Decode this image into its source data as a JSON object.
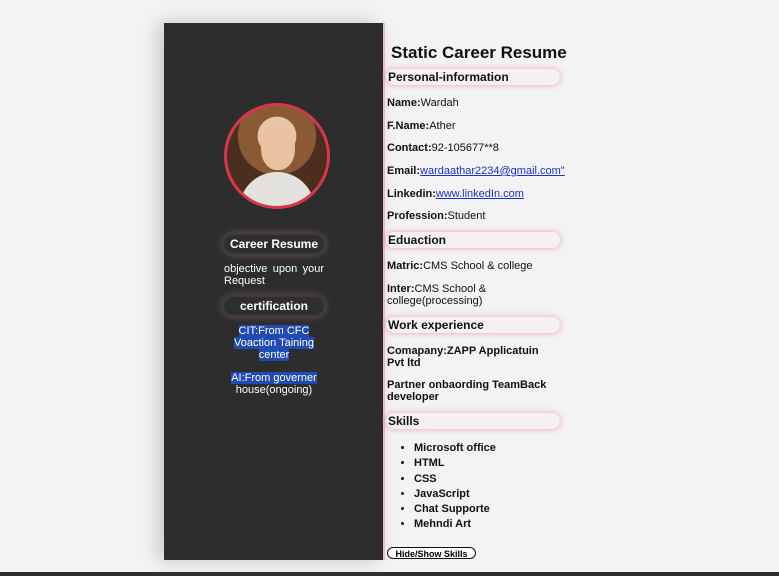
{
  "sidebar": {
    "heading": "Career Resume",
    "objective": "objective upon your Request",
    "certification_heading": "certification",
    "certifications": [
      {
        "title": "CIT:From CFC Voaction Taining center",
        "note": ""
      },
      {
        "title": "AI:From governer",
        "note": "house(ongoing)"
      }
    ]
  },
  "main": {
    "title": "Static Career Resume",
    "personal_heading": "Personal-information",
    "personal": [
      {
        "label": "Name:",
        "value": "Wardah"
      },
      {
        "label": "F.Name:",
        "value": "Ather"
      },
      {
        "label": "Contact:",
        "value": "92-105677**8"
      },
      {
        "label": "Email:",
        "value": "wardaathar2234@gmail.com\""
      },
      {
        "label": "Linkedin:",
        "value": "www.linkedIn.com"
      },
      {
        "label": "Profession:",
        "value": "Student"
      }
    ],
    "education_heading": "Eduaction",
    "education": [
      {
        "label": "Matric:",
        "value": "CMS School & college"
      },
      {
        "label": "Inter:",
        "value": "CMS School & college(processing)"
      }
    ],
    "work_heading": "Work experience",
    "work": [
      {
        "text": "Comapany:ZAPP Applicatuin Pvt ltd"
      },
      {
        "text": "Partner onbaording TeamBack developer"
      }
    ],
    "skills_heading": "Skills",
    "skills": [
      "Microsoft office",
      "HTML",
      "CSS",
      "JavaScript",
      "Chat Supporte",
      "Mehndi Art"
    ],
    "toggle_label": "Hide/Show Skills"
  }
}
